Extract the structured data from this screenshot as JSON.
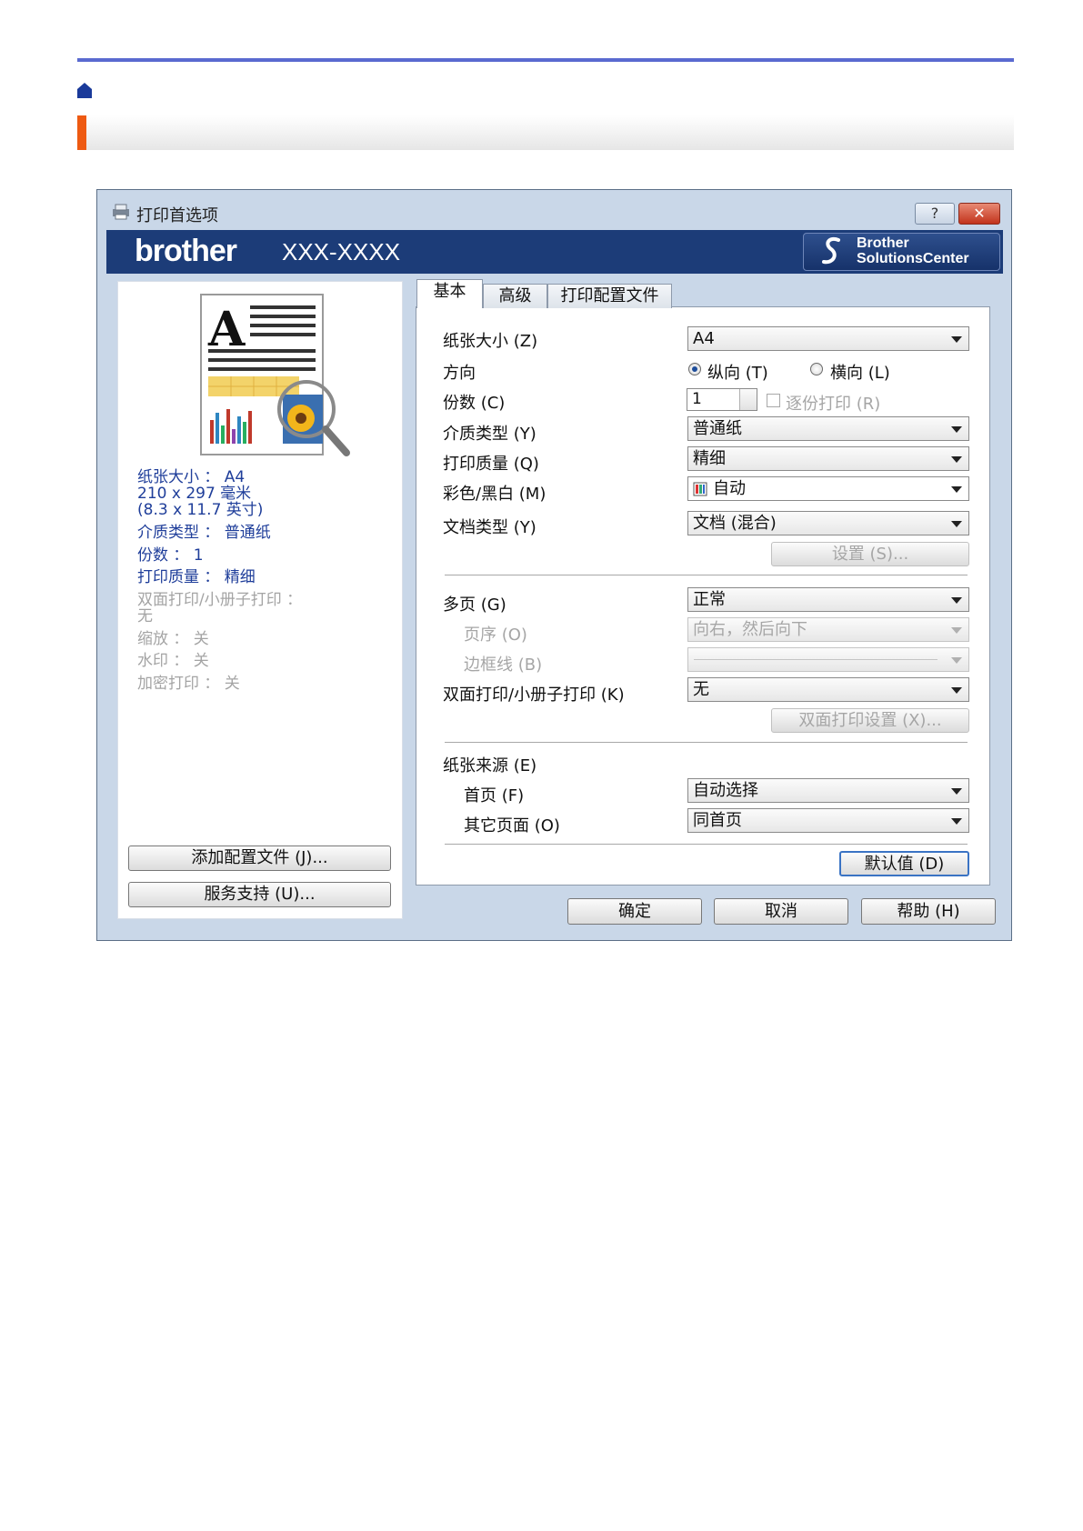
{
  "header": {
    "home_icon": "home-icon",
    "accent_color": "#ee5a12",
    "rule_color": "#5a6ad0"
  },
  "dialog": {
    "title": "打印首选项",
    "help_label": "?",
    "close_label": "✕",
    "brand": "brother",
    "model": "XXX-XXXX",
    "solutions_center": {
      "line1": "Brother",
      "line2": "SolutionsCenter"
    }
  },
  "summary": {
    "paper_size": "纸张大小 ： A4",
    "dims_mm": "210 x 297 毫米",
    "dims_in": "(8.3 x 11.7 英寸)",
    "media_type": "介质类型 ： 普通纸",
    "copies": "份数 ： 1",
    "quality": "打印质量 ： 精细",
    "duplex": "双面打印/小册子打印 ：",
    "duplex_value": "无",
    "scaling": "缩放 ： 关",
    "watermark": "水印 ： 关",
    "secure": "加密打印 ： 关"
  },
  "left_buttons": {
    "add_profile": "添加配置文件 (J)...",
    "support": "服务支持 (U)..."
  },
  "tabs": [
    {
      "label": "基本",
      "active": true
    },
    {
      "label": "高级",
      "active": false
    },
    {
      "label": "打印配置文件",
      "active": false
    }
  ],
  "basic": {
    "paper_size": {
      "label": "纸张大小 (Z)",
      "value": "A4"
    },
    "orientation": {
      "label": "方向",
      "portrait": "纵向 (T)",
      "landscape": "横向 (L)",
      "selected": "portrait"
    },
    "copies": {
      "label": "份数 (C)",
      "value": "1",
      "collate": "逐份打印 (R)"
    },
    "media_type": {
      "label": "介质类型 (Y)",
      "value": "普通纸"
    },
    "quality": {
      "label": "打印质量 (Q)",
      "value": "精细"
    },
    "color_mode": {
      "label": "彩色/黑白 (M)",
      "value": "自动"
    },
    "doc_type": {
      "label": "文档类型 (Y)",
      "value": "文档 (混合)"
    },
    "settings_button": "设置 (S)...",
    "multi_page": {
      "label": "多页 (G)",
      "value": "正常"
    },
    "page_order": {
      "label": "页序 (O)",
      "value": "向右，然后向下"
    },
    "border_line": {
      "label": "边框线 (B)",
      "value": ""
    },
    "duplex": {
      "label": "双面打印/小册子打印 (K)",
      "value": "无"
    },
    "duplex_settings_button": "双面打印设置 (X)...",
    "paper_source": {
      "label": "纸张来源 (E)"
    },
    "first_page": {
      "label": "首页 (F)",
      "value": "自动选择"
    },
    "other_pages": {
      "label": "其它页面 (O)",
      "value": "同首页"
    },
    "default_button": "默认值 (D)"
  },
  "footer": {
    "ok": "确定",
    "cancel": "取消",
    "help": "帮助 (H)"
  }
}
